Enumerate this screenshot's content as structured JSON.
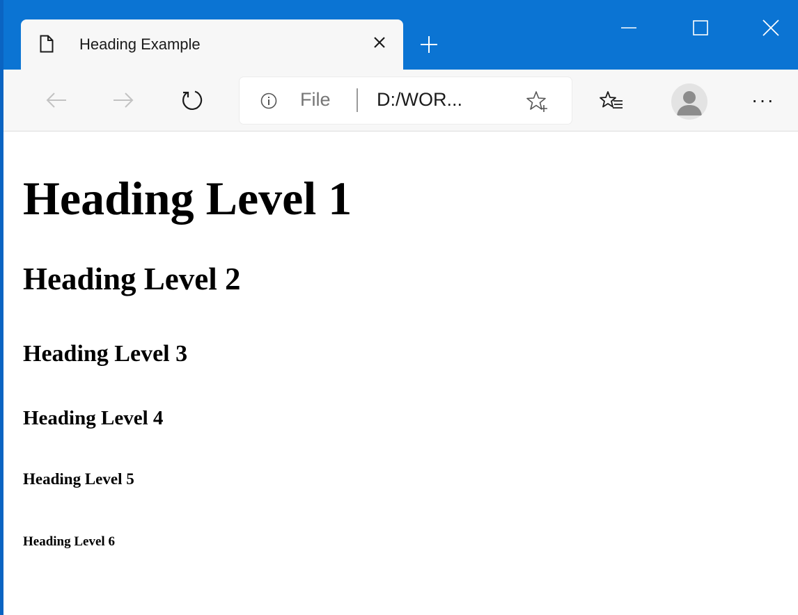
{
  "browser": {
    "tab": {
      "title": "Heading Example"
    },
    "address": {
      "scheme": "File",
      "url": "D:/WOR..."
    },
    "icons": {
      "page": "page-icon",
      "close": "close-icon",
      "new_tab": "plus-icon",
      "back": "back-arrow-icon",
      "forward": "forward-arrow-icon",
      "refresh": "refresh-icon",
      "info": "info-icon",
      "add_favorite": "star-plus-icon",
      "favorites": "favorites-list-icon",
      "profile": "avatar-icon",
      "more": "more-icon"
    },
    "more_label": "···",
    "colors": {
      "titlebar": "#0b74d3",
      "toolbar": "#f7f7f7",
      "accent_edge": "#0a64c2"
    }
  },
  "page": {
    "headings": {
      "h1": "Heading Level 1",
      "h2": "Heading Level 2",
      "h3": "Heading Level 3",
      "h4": "Heading Level 4",
      "h5": "Heading Level 5",
      "h6": "Heading Level 6"
    }
  }
}
